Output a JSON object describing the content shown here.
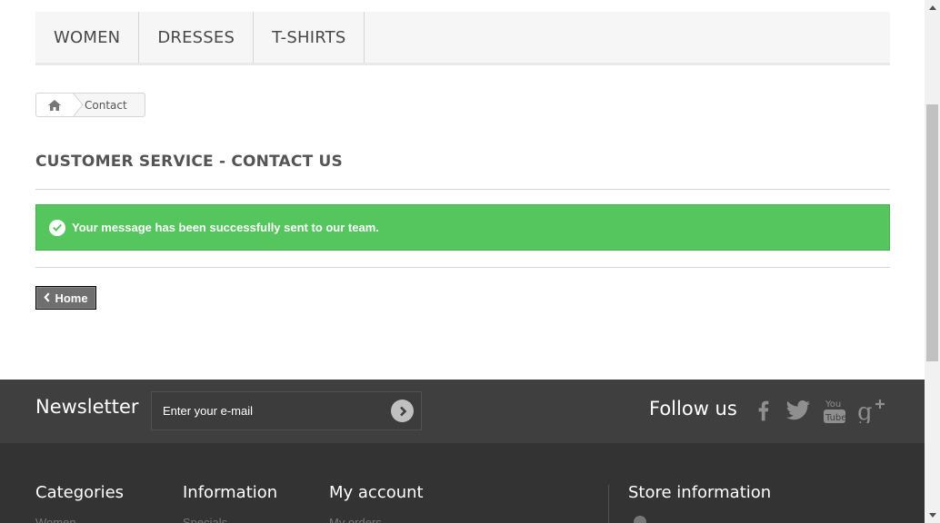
{
  "menu": {
    "items": [
      {
        "label": "WOMEN"
      },
      {
        "label": "DRESSES"
      },
      {
        "label": "T-SHIRTS"
      }
    ]
  },
  "breadcrumb": {
    "home_icon": "home-icon",
    "current": "Contact"
  },
  "heading": "CUSTOMER SERVICE - CONTACT US",
  "alert": {
    "icon": "check-circle-icon",
    "text": "Your message has been successfully sent to our team.",
    "color": "#55c65e"
  },
  "home_button": {
    "icon": "chevron-left-icon",
    "label": "Home"
  },
  "newsletter": {
    "title": "Newsletter",
    "placeholder": "Enter your e-mail",
    "submit_icon": "arrow-right-circle-icon"
  },
  "follow": {
    "title": "Follow us",
    "icons": [
      "facebook-icon",
      "twitter-icon",
      "youtube-icon",
      "google-plus-icon"
    ]
  },
  "footer": {
    "columns": [
      {
        "title": "Categories",
        "first_link": "Women"
      },
      {
        "title": "Information",
        "first_link": "Specials"
      },
      {
        "title": "My account",
        "first_link": "My orders"
      },
      {
        "title": "Store information",
        "first_link": ""
      }
    ]
  }
}
